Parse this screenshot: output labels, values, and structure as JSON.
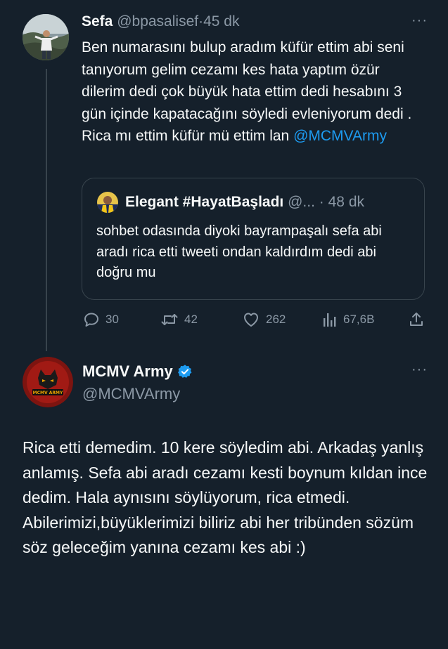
{
  "tweet1": {
    "display_name": "Sefa",
    "handle": "@bpasalisef",
    "separator": "·",
    "time": "45 dk",
    "more_label": "···",
    "body_text": "Ben numarasını bulup aradım küfür ettim abi seni tanıyorum gelim cezamı kes hata yaptım özür dilerim dedi çok büyük hata ettim dedi hesabını 3 gün içinde kapatacağını söyledi evleniyorum dedi . Rica mı ettim  küfür mü ettim lan ",
    "mention": "@MCMVArmy",
    "quote": {
      "display_name": "Elegant #HayatBaşladı",
      "handle": "@...",
      "separator": "·",
      "time": "48 dk",
      "body_text": "sohbet odasında diyoki bayrampaşalı sefa abi aradı rica etti tweeti ondan kaldırdım dedi abi doğru mu"
    },
    "actions": {
      "reply_count": "30",
      "retweet_count": "42",
      "like_count": "262",
      "views_count": "67,6B"
    }
  },
  "tweet2": {
    "display_name": "MCMV Army",
    "handle": "@MCMVArmy",
    "more_label": "···",
    "avatar_text": "MCMV ARMY",
    "body_text": "Rica etti demedim. 10 kere söyledim abi. Arkadaş yanlış anlamış. Sefa abi aradı cezamı kesti boynum kıldan ince dedim. Hala aynısını söylüyorum, rica etmedi.\nAbilerimizi,büyüklerimizi biliriz abi her tribünden sözüm söz geleceğim yanına cezamı kes abi :)"
  },
  "colors": {
    "background": "#15202b",
    "text": "#f7f9f9",
    "muted": "#8b98a5",
    "link": "#1d9bf0",
    "border": "#38444d"
  }
}
